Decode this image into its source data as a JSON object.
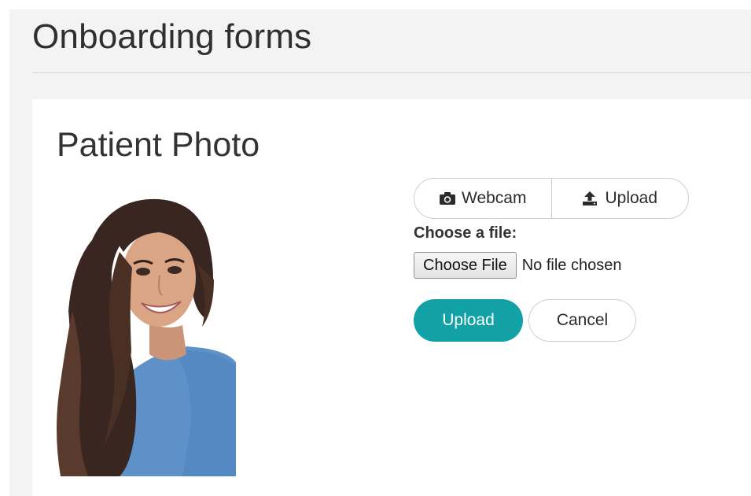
{
  "page": {
    "title": "Onboarding forms"
  },
  "card": {
    "title": "Patient Photo"
  },
  "source_tabs": [
    {
      "label": "Webcam",
      "icon": "camera-icon"
    },
    {
      "label": "Upload",
      "icon": "upload-icon"
    }
  ],
  "file_input": {
    "label": "Choose a file:",
    "button_label": "Choose File",
    "status": "No file chosen"
  },
  "actions": {
    "upload_label": "Upload",
    "cancel_label": "Cancel"
  },
  "colors": {
    "primary": "#12a1a5",
    "page_background": "#f3f3f3"
  }
}
